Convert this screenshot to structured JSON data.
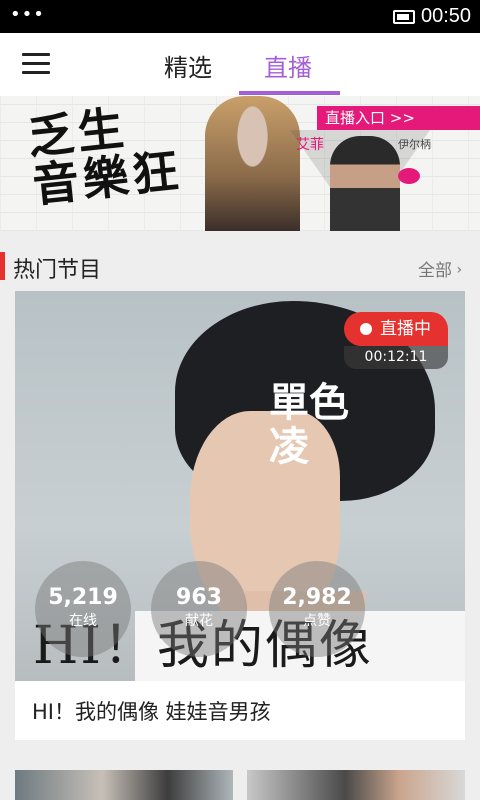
{
  "status_bar": {
    "time": "00:50"
  },
  "header": {
    "tabs": [
      {
        "label": "精选",
        "active": false
      },
      {
        "label": "直播",
        "active": true
      }
    ],
    "accent_color": "#a55fd6"
  },
  "banner": {
    "calligraphy_text": "乏生\n音樂狂",
    "entry_label": "直播入口 >>",
    "name_tag_left": "艾菲",
    "name_tag_right": "伊尔柄",
    "accent_color": "#e5197a"
  },
  "section": {
    "title": "热门节目",
    "more_label": "全部",
    "more_icon": "chevron-right-icon",
    "accent_color": "#e5322f"
  },
  "featured": {
    "live_label": "直播中",
    "elapsed": "00:12:11",
    "photo_title": "單色\n凌",
    "photo_slogan": "HI！我的偶像",
    "stats": [
      {
        "value": "5,219",
        "label": "在线"
      },
      {
        "value": "963",
        "label": "献花"
      },
      {
        "value": "2,982",
        "label": "点赞"
      }
    ],
    "caption": "HI！我的偶像 娃娃音男孩"
  }
}
